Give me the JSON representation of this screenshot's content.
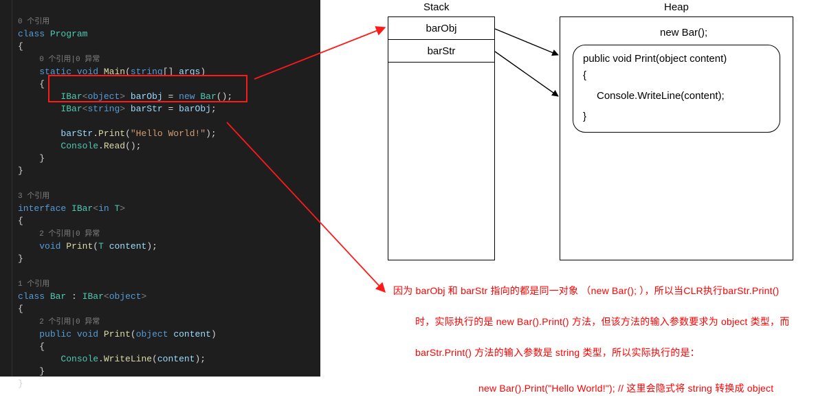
{
  "code": {
    "hint_refs0": "0 个引用",
    "hint_refs1": "1 个引用",
    "hint_refs2": "2 个引用|0 异常",
    "hint_refs3": "3 个引用",
    "hint_refs0e": "0 个引用|0 异常",
    "kw_class": "class",
    "kw_static": "static",
    "kw_void": "void",
    "kw_new": "new",
    "kw_interface": "interface",
    "kw_in": "in",
    "kw_public": "public",
    "type_program": "Program",
    "type_string": "string",
    "type_object": "object",
    "type_ibar": "IBar",
    "type_bar": "Bar",
    "type_console": "Console",
    "type_t": "T",
    "fn_main": "Main",
    "fn_print": "Print",
    "fn_read": "Read",
    "fn_writeline": "WriteLine",
    "id_args": "args",
    "id_barobj": "barObj",
    "id_barstr": "barStr",
    "id_content": "content",
    "str_hello": "\"Hello World!\""
  },
  "diagram": {
    "stack_label": "Stack",
    "heap_label": "Heap",
    "stack_cells": [
      "barObj",
      "barStr"
    ],
    "heap_new": "new Bar();",
    "heap_method_sig": "public void Print(object content)",
    "heap_open": "{",
    "heap_body": "Console.WriteLine(content);",
    "heap_close": "}"
  },
  "notes": {
    "line1": "因为 barObj 和 barStr 指向的都是同一对象 （new Bar(); ），所以当CLR执行barStr.Print()",
    "line2": "时，实际执行的是 new Bar().Print() 方法，但该方法的输入参数要求为 object 类型，而",
    "line3": "barStr.Print() 方法的输入参数是 string 类型，所以实际执行的是：",
    "line4": "new Bar().Print(\"Hello World!\");  // 这里会隐式将 string 转换成 object"
  }
}
